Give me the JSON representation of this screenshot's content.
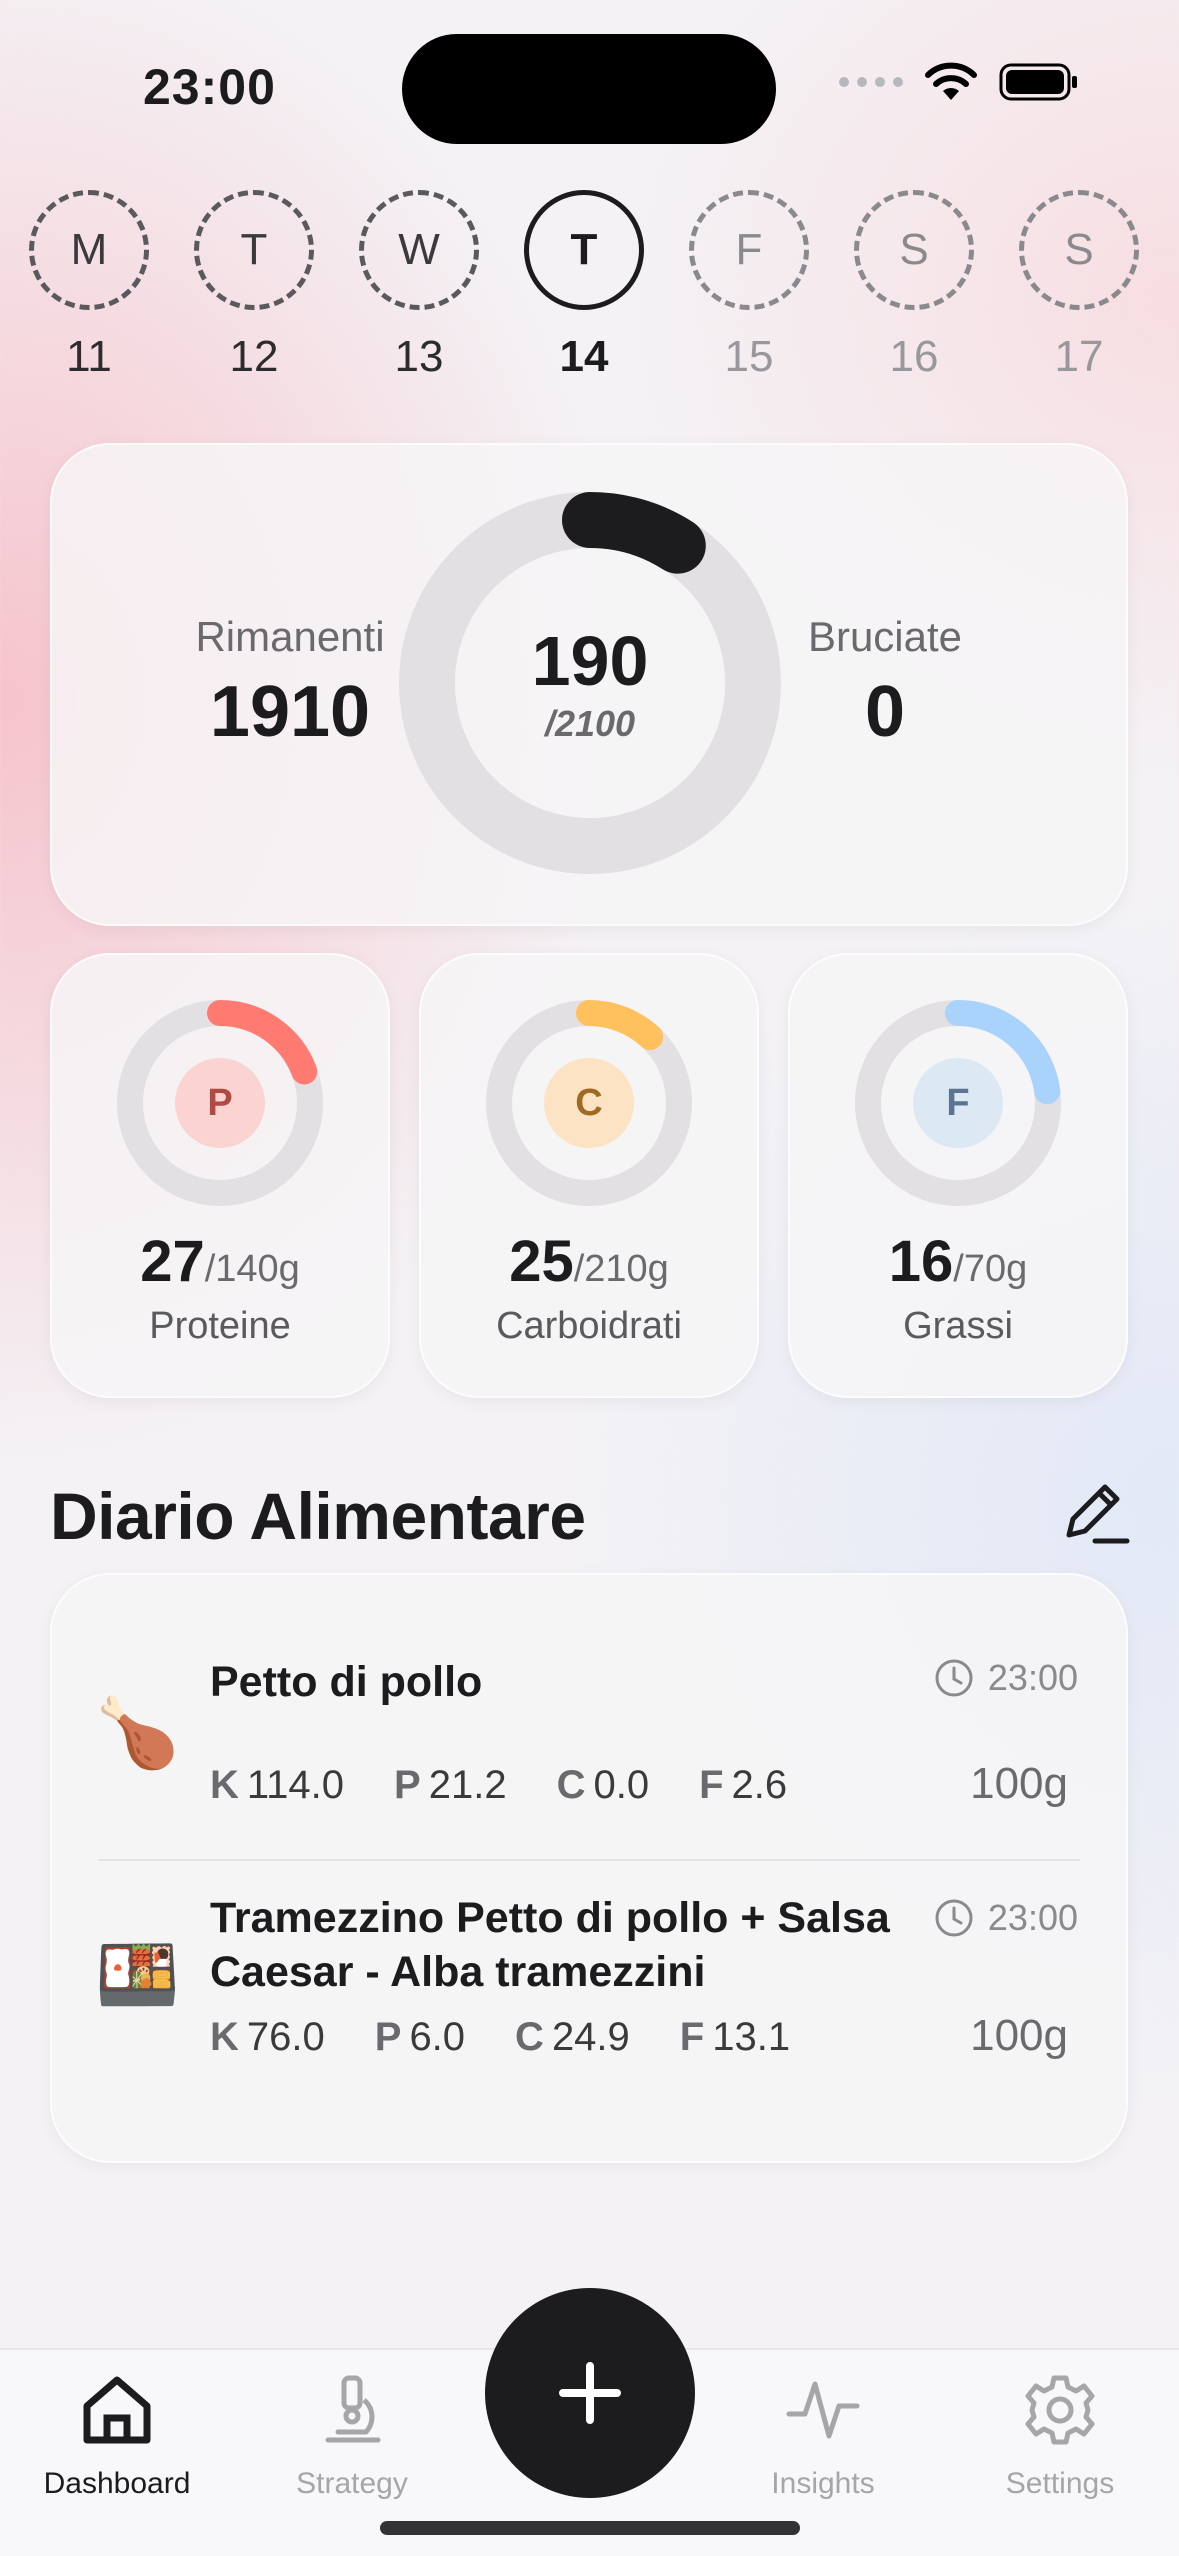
{
  "status": {
    "time": "23:00"
  },
  "week": [
    {
      "letter": "M",
      "date": "11",
      "state": "past"
    },
    {
      "letter": "T",
      "date": "12",
      "state": "past"
    },
    {
      "letter": "W",
      "date": "13",
      "state": "past"
    },
    {
      "letter": "T",
      "date": "14",
      "state": "current"
    },
    {
      "letter": "F",
      "date": "15",
      "state": "future"
    },
    {
      "letter": "S",
      "date": "16",
      "state": "future"
    },
    {
      "letter": "S",
      "date": "17",
      "state": "future"
    }
  ],
  "summary": {
    "remaining_label": "Rimanenti",
    "remaining_value": "1910",
    "burned_label": "Bruciate",
    "burned_value": "0",
    "consumed": "190",
    "goal": "/2100",
    "progress": 0.0905
  },
  "macros": [
    {
      "letter": "P",
      "value": "27",
      "target": "/140g",
      "name": "Proteine",
      "progress": 0.193,
      "color": "#ff7b72",
      "badge_bg": "#fbd3d1",
      "badge_fg": "#b04a44"
    },
    {
      "letter": "C",
      "value": "25",
      "target": "/210g",
      "name": "Carboidrati",
      "progress": 0.119,
      "color": "#ffc15e",
      "badge_bg": "#fbe3c4",
      "badge_fg": "#a06a22"
    },
    {
      "letter": "F",
      "value": "16",
      "target": "/70g",
      "name": "Grassi",
      "progress": 0.229,
      "color": "#a9d3fb",
      "badge_bg": "#dde8f5",
      "badge_fg": "#5b7590"
    }
  ],
  "diary": {
    "title": "Diario Alimentare",
    "entries": [
      {
        "emoji": "🍗",
        "name": "Petto di pollo",
        "time": "23:00",
        "k": "114.0",
        "p": "21.2",
        "c": "0.0",
        "f": "2.6",
        "qty": "100g"
      },
      {
        "emoji": "🍱",
        "name": "Tramezzino Petto di pollo + Salsa Caesar - Alba tramezzini",
        "time": "23:00",
        "k": "76.0",
        "p": "6.0",
        "c": "24.9",
        "f": "13.1",
        "qty": "100g"
      }
    ],
    "macro_letters": {
      "k": "K",
      "p": "P",
      "c": "C",
      "f": "F"
    }
  },
  "tabs": {
    "dashboard": "Dashboard",
    "strategy": "Strategy",
    "insights": "Insights",
    "settings": "Settings"
  }
}
